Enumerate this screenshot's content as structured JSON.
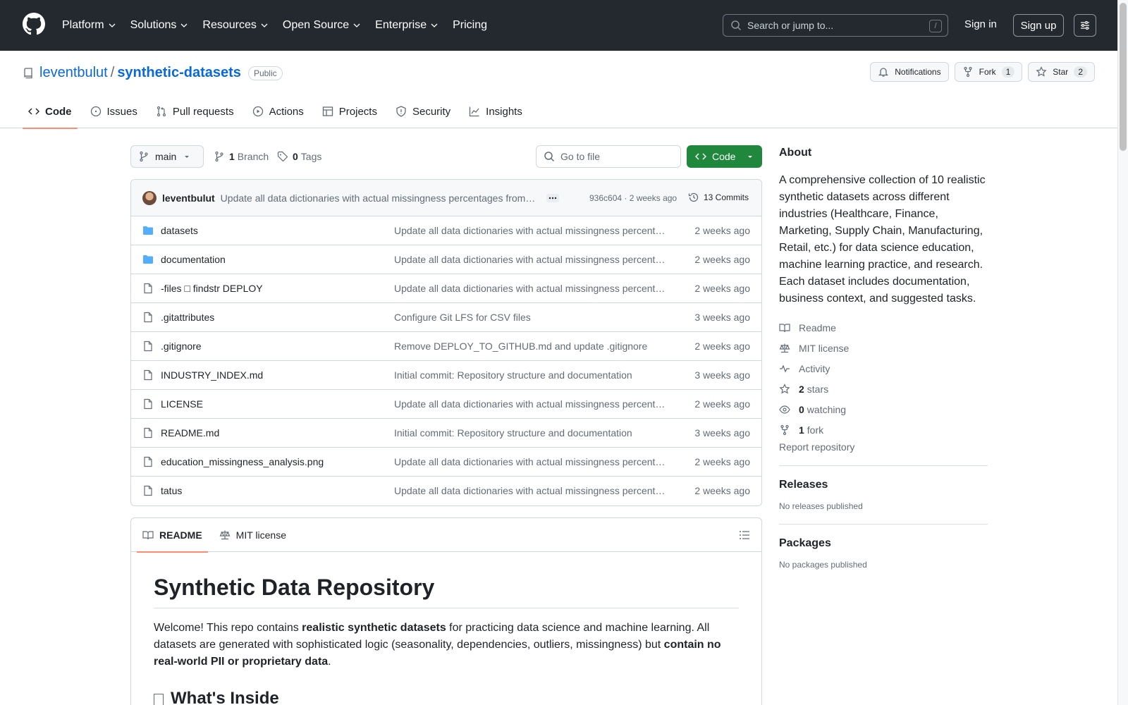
{
  "header": {
    "nav": [
      "Platform",
      "Solutions",
      "Resources",
      "Open Source",
      "Enterprise",
      "Pricing"
    ],
    "search_placeholder": "Search or jump to...",
    "search_key": "/",
    "sign_in": "Sign in",
    "sign_up": "Sign up"
  },
  "repo": {
    "owner": "leventbulut",
    "separator": "/",
    "name": "synthetic-datasets",
    "visibility": "Public",
    "notifications": "Notifications",
    "fork_label": "Fork",
    "fork_count": "1",
    "star_label": "Star",
    "star_count": "2"
  },
  "tabs": [
    "Code",
    "Issues",
    "Pull requests",
    "Actions",
    "Projects",
    "Security",
    "Insights"
  ],
  "toolbar": {
    "branch": "main",
    "branch_count": "1",
    "branch_label": "Branch",
    "tag_count": "0",
    "tag_label": "Tags",
    "goto_placeholder": "Go to file",
    "code_label": "Code"
  },
  "commit": {
    "author": "leventbulut",
    "message": "Update all data dictionaries with actual missingness percentages from analysis",
    "hash_age": "936c604 · 2 weeks ago",
    "commits": "13 Commits"
  },
  "files": [
    {
      "type": "dir",
      "name": "datasets",
      "message": "Update all data dictionaries with actual missingness percentages from analysis",
      "date": "2 weeks ago"
    },
    {
      "type": "dir",
      "name": "documentation",
      "message": "Update all data dictionaries with actual missingness percentages from analysis",
      "date": "2 weeks ago"
    },
    {
      "type": "file",
      "name": "-files □ findstr DEPLOY",
      "message": "Update all data dictionaries with actual missingness percentages from analysis",
      "date": "2 weeks ago"
    },
    {
      "type": "file",
      "name": ".gitattributes",
      "message": "Configure Git LFS for CSV files",
      "date": "3 weeks ago"
    },
    {
      "type": "file",
      "name": ".gitignore",
      "message": "Remove DEPLOY_TO_GITHUB.md and update .gitignore",
      "date": "2 weeks ago"
    },
    {
      "type": "file",
      "name": "INDUSTRY_INDEX.md",
      "message": "Initial commit: Repository structure and documentation",
      "date": "3 weeks ago"
    },
    {
      "type": "file",
      "name": "LICENSE",
      "message": "Update all data dictionaries with actual missingness percentages from analysis",
      "date": "2 weeks ago"
    },
    {
      "type": "file",
      "name": "README.md",
      "message": "Initial commit: Repository structure and documentation",
      "date": "3 weeks ago"
    },
    {
      "type": "file",
      "name": "education_missingness_analysis.png",
      "message": "Update all data dictionaries with actual missingness percentages from analysis",
      "date": "2 weeks ago"
    },
    {
      "type": "file",
      "name": "tatus",
      "message": "Update all data dictionaries with actual missingness percentages from analysis",
      "date": "2 weeks ago"
    }
  ],
  "readme": {
    "tab_readme": "README",
    "tab_license": "MIT license",
    "title": "Synthetic Data Repository",
    "p1": "Welcome! This repo contains ",
    "p1_bold": "realistic synthetic datasets",
    "p2": " for practicing data science and machine learning. All datasets are generated with sophisticated logic (seasonality, dependencies, outliers, missingness) but ",
    "p2_bold": "contain no real-world PII or proprietary data",
    "p3": ".",
    "h2": "What's Inside"
  },
  "sidebar": {
    "about_title": "About",
    "about": "A comprehensive collection of 10 realistic synthetic datasets across different industries (Healthcare, Finance, Marketing, Supply Chain, Manufacturing, Retail, etc.) for data science education, machine learning practice, and research. Each dataset includes documentation, business context, and suggested tasks.",
    "readme": "Readme",
    "license": "MIT license",
    "activity": "Activity",
    "stars_count": "2",
    "stars_label": "stars",
    "watching_count": "0",
    "watching_label": "watching",
    "fork_count": "1",
    "fork_label": "fork",
    "report": "Report repository",
    "releases_title": "Releases",
    "releases_sub": "No releases published",
    "packages_title": "Packages",
    "packages_sub": "No packages published"
  }
}
